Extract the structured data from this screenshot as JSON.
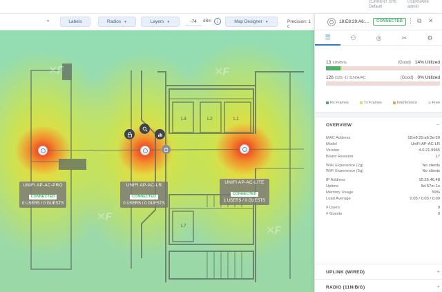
{
  "header": {
    "current_site_label": "CURRENT SITE",
    "current_site_value": "Default",
    "username_label": "USERNAME",
    "username_value": "admin"
  },
  "toolbar": {
    "labels_btn": "Labels",
    "radios_btn": "Radios",
    "layers_btn": "Layers",
    "signal_value": "-74",
    "signal_unit": "dBm",
    "map_designer_btn": "Map Designer",
    "precision_label": "Precision: 1 c"
  },
  "map": {
    "rooms": [
      "L3",
      "L2",
      "L1",
      "L7"
    ],
    "aps": [
      {
        "name": "UNIFI AP-AC-PRO",
        "status": "CONNECTED",
        "counts": "0 USERS / 0 GUESTS"
      },
      {
        "name": "UNIFI AP-AC-LR",
        "status": "CONNECTED",
        "counts": "0 USERS / 0 GUESTS"
      },
      {
        "name": "UNIFI AP-AC-LITE",
        "status": "CONNECTED",
        "counts": "1 USERS / 0 GUESTS"
      }
    ]
  },
  "panel": {
    "device_mac": "18:E8:29:A6:...",
    "device_status": "CONNECTED",
    "radios": [
      {
        "label_num": "13",
        "label_band": "11N/B/G",
        "quality": "(Good)",
        "util": "14% Utilized",
        "rx_fill": 0.13,
        "tx_fill": 0.01
      },
      {
        "label_num": "126",
        "label_band": "(128,-1) 11N/A/AC",
        "quality": "(Good)",
        "util": "0% Utilized",
        "rx_fill": 0.0,
        "tx_fill": 0.0
      }
    ],
    "legend": [
      {
        "label": "Rx Frames",
        "color": "#4cae6a"
      },
      {
        "label": "Tx Frames",
        "color": "#d9e06a"
      },
      {
        "label": "Interference",
        "color": "#f0a24c"
      },
      {
        "label": "Free",
        "color": "#eedad8"
      }
    ],
    "overview_title": "OVERVIEW",
    "overview": [
      {
        "k": "MAC Address",
        "v": "18:e8:29:a6:3e:50"
      },
      {
        "k": "Model",
        "v": "UniFi AP-AC-LR"
      },
      {
        "k": "Version",
        "v": "4.0.21.9965"
      },
      {
        "k": "Board Revision",
        "v": "17"
      },
      {
        "k": "WiFi Experience (2g)",
        "v": "No clients"
      },
      {
        "k": "WiFi Experience (5g)",
        "v": "No clients"
      },
      {
        "k": "IP Address",
        "v": "10.26.46.48"
      },
      {
        "k": "Uptime",
        "v": "5d 57m 1s"
      },
      {
        "k": "Memory Usage",
        "v": "59%"
      },
      {
        "k": "Load Average",
        "v": "0.03 / 0.03 / 0.00"
      },
      {
        "k": "# Users",
        "v": "0"
      },
      {
        "k": "# Guests",
        "v": "0"
      }
    ],
    "uplink_title": "UPLINK (WIRED)",
    "radio_title": "RADIO (11N/B/G)",
    "toggle_minus": "−",
    "toggle_plus": "+"
  }
}
